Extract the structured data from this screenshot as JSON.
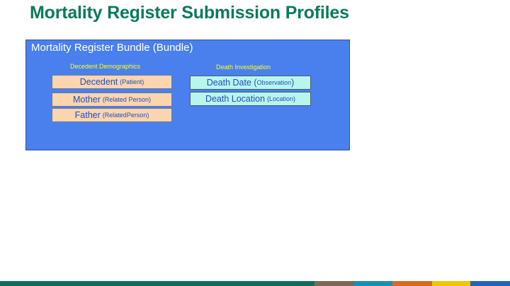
{
  "title": "Mortality Register Submission Profiles",
  "bundle": {
    "title": "Mortality Register Bundle (Bundle)",
    "groups": [
      {
        "label": "Decedent Demographics",
        "items": [
          {
            "name": "Decedent",
            "type": "(Patient)"
          },
          {
            "name": "Mother",
            "type": "(Related Person)"
          },
          {
            "name": "Father",
            "type": "(RelatedPerson)"
          }
        ]
      },
      {
        "label": "Death Investigation",
        "items": [
          {
            "name": "Death Date (",
            "type": "Observation",
            "suffix": ")"
          },
          {
            "name": "Death Location",
            "type": "(Location)"
          }
        ]
      }
    ]
  },
  "colors": {
    "title": "#0b7a5c",
    "bundle_fill": "#4a80ee",
    "group_label": "#ffff1a",
    "demographics_card": "#fbd4b0",
    "investigation_card": "#b7f6ec",
    "footer_segments": [
      "#0d6e5c",
      "#7a6a55",
      "#1a8fb5",
      "#d56d1f",
      "#f5c400",
      "#1c68b5"
    ]
  }
}
